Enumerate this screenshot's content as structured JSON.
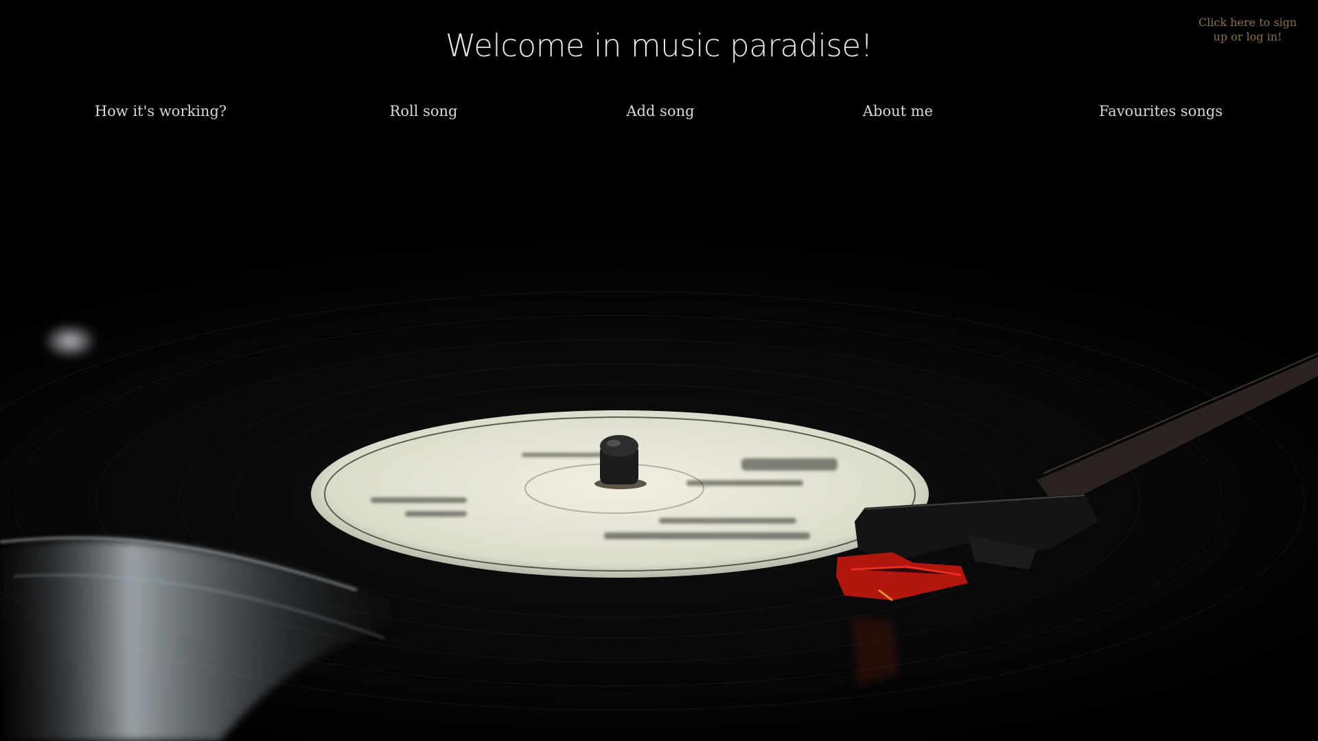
{
  "header": {
    "title": "Welcome in music paradise!",
    "auth_link": "Click here to sign up or log in!"
  },
  "nav": {
    "items": [
      {
        "label": "How it's working?"
      },
      {
        "label": "Roll song"
      },
      {
        "label": "Add song"
      },
      {
        "label": "About me"
      },
      {
        "label": "Favourites songs"
      }
    ]
  },
  "colors": {
    "background": "#000000",
    "title_text": "#e8e8e8",
    "nav_text": "#d9d9d9",
    "auth_link_text": "#8a7340"
  },
  "icons": {
    "background_image": "vinyl-turntable-photo"
  }
}
